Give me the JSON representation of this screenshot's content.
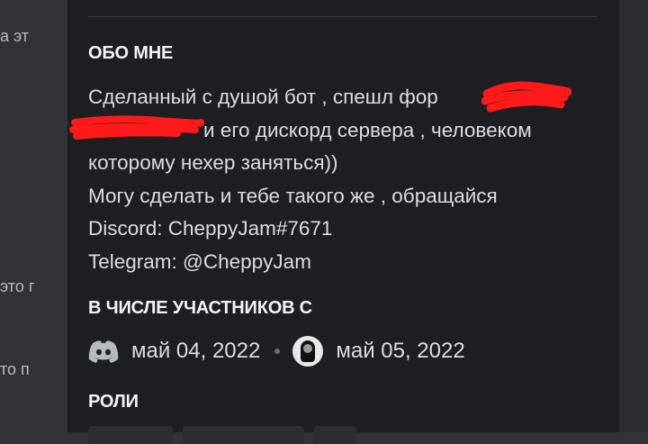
{
  "background_chat": {
    "fragments": [
      "а эт",
      "это г",
      "то п"
    ]
  },
  "profile": {
    "about_title": "ОБО МНЕ",
    "about_lines": [
      "Сделанный с душой бот , спешл фор",
      "и его дискорд сервера , человеком",
      "которому нехер заняться))",
      "Могу сделать и тебе такого же , обращайся",
      "Discord: CheppyJam#7671",
      "Telegram: @CheppyJam"
    ],
    "member_since_title": "В ЧИСЛЕ УЧАСТНИКОВ С",
    "discord_since": "май 04, 2022",
    "server_since": "май 05, 2022",
    "roles_title": "РОЛИ"
  },
  "icons": {
    "discord": "discord-logo-icon",
    "server": "server-avatar-icon"
  },
  "colors": {
    "popout_bg": "#1e1f22",
    "redaction": "#ff1a1a",
    "discord_icon": "#b5bac1"
  }
}
